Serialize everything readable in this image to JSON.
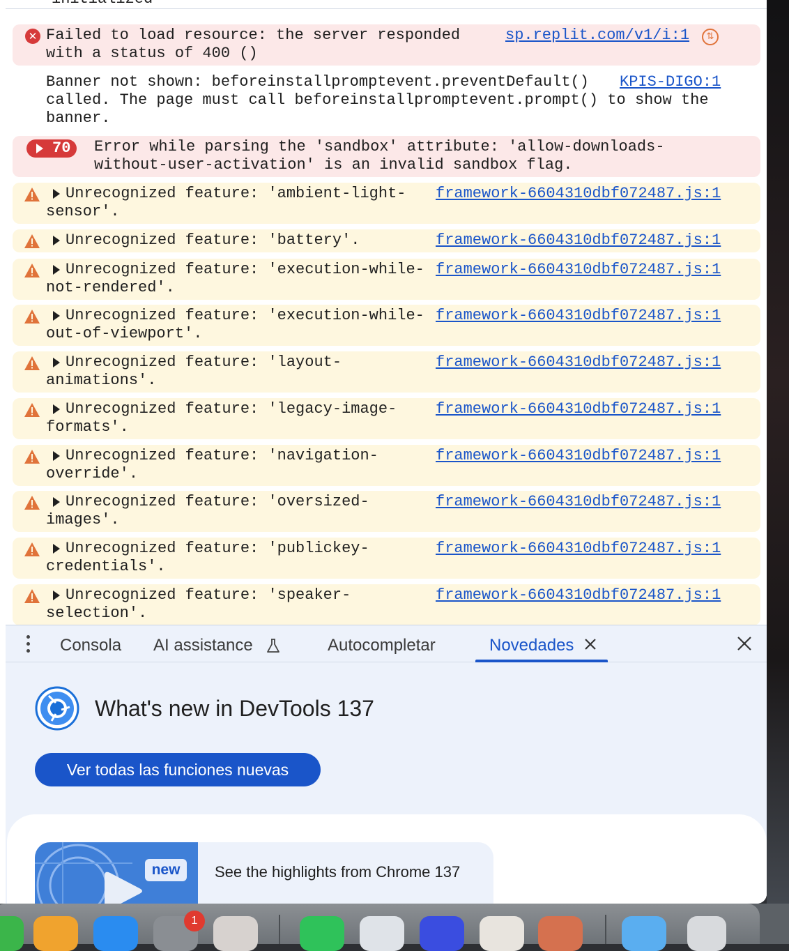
{
  "console": {
    "top_fragment": "initialized",
    "messages": [
      {
        "level": "error",
        "lines": [
          "Failed to load resource: the server responded",
          "with a status of 400 ()"
        ],
        "source": "sp.replit.com/v1/i:1"
      },
      {
        "level": "info",
        "lines": [
          "Banner not shown: beforeinstallpromptevent.preventDefault()",
          "called. The page must call beforeinstallpromptevent.prompt() to show the",
          "banner."
        ],
        "source": "KPIS-DIGO:1"
      },
      {
        "level": "error-group",
        "count": "70",
        "lines": [
          "Error while parsing the 'sandbox' attribute: 'allow-downloads-",
          "without-user-activation' is an invalid sandbox flag."
        ]
      },
      {
        "level": "warning",
        "lines": [
          "Unrecognized feature: 'ambient-light-",
          "sensor'."
        ],
        "source": "framework-6604310dbf072487.js:1"
      },
      {
        "level": "warning",
        "lines": [
          "Unrecognized feature: 'battery'."
        ],
        "source": "framework-6604310dbf072487.js:1"
      },
      {
        "level": "warning",
        "lines": [
          "Unrecognized feature: 'execution-while-",
          "not-rendered'."
        ],
        "source": "framework-6604310dbf072487.js:1"
      },
      {
        "level": "warning",
        "lines": [
          "Unrecognized feature: 'execution-while-",
          "out-of-viewport'."
        ],
        "source": "framework-6604310dbf072487.js:1"
      },
      {
        "level": "warning",
        "lines": [
          "Unrecognized feature: 'layout-",
          "animations'."
        ],
        "source": "framework-6604310dbf072487.js:1"
      },
      {
        "level": "warning",
        "lines": [
          "Unrecognized feature: 'legacy-image-",
          "formats'."
        ],
        "source": "framework-6604310dbf072487.js:1"
      },
      {
        "level": "warning",
        "lines": [
          "Unrecognized feature: 'navigation-",
          "override'."
        ],
        "source": "framework-6604310dbf072487.js:1"
      },
      {
        "level": "warning",
        "lines": [
          "Unrecognized feature: 'oversized-",
          "images'."
        ],
        "source": "framework-6604310dbf072487.js:1"
      },
      {
        "level": "warning",
        "lines": [
          "Unrecognized feature: 'publickey-",
          "credentials'."
        ],
        "source": "framework-6604310dbf072487.js:1"
      },
      {
        "level": "warning",
        "lines": [
          "Unrecognized feature: 'speaker-",
          "selection'."
        ],
        "source": "framework-6604310dbf072487.js:1"
      }
    ]
  },
  "drawer": {
    "tabs": [
      {
        "label": "Consola"
      },
      {
        "label": "AI assistance"
      },
      {
        "label": "Autocompletar"
      },
      {
        "label": "Novedades",
        "active": true
      }
    ],
    "whats_new": {
      "title": "What's new in DevTools 137",
      "button_label": "Ver todas las funciones nuevas",
      "highlight_badge": "new",
      "highlight_text": "See the highlights from Chrome 137"
    }
  },
  "dock": {
    "settings_badge": "1"
  },
  "colors": {
    "accent": "#1a55c9",
    "error_bg": "#fce8e8",
    "warning_bg": "#fef7df",
    "error_icon": "#d63a3a",
    "warning_icon": "#e0733a"
  }
}
